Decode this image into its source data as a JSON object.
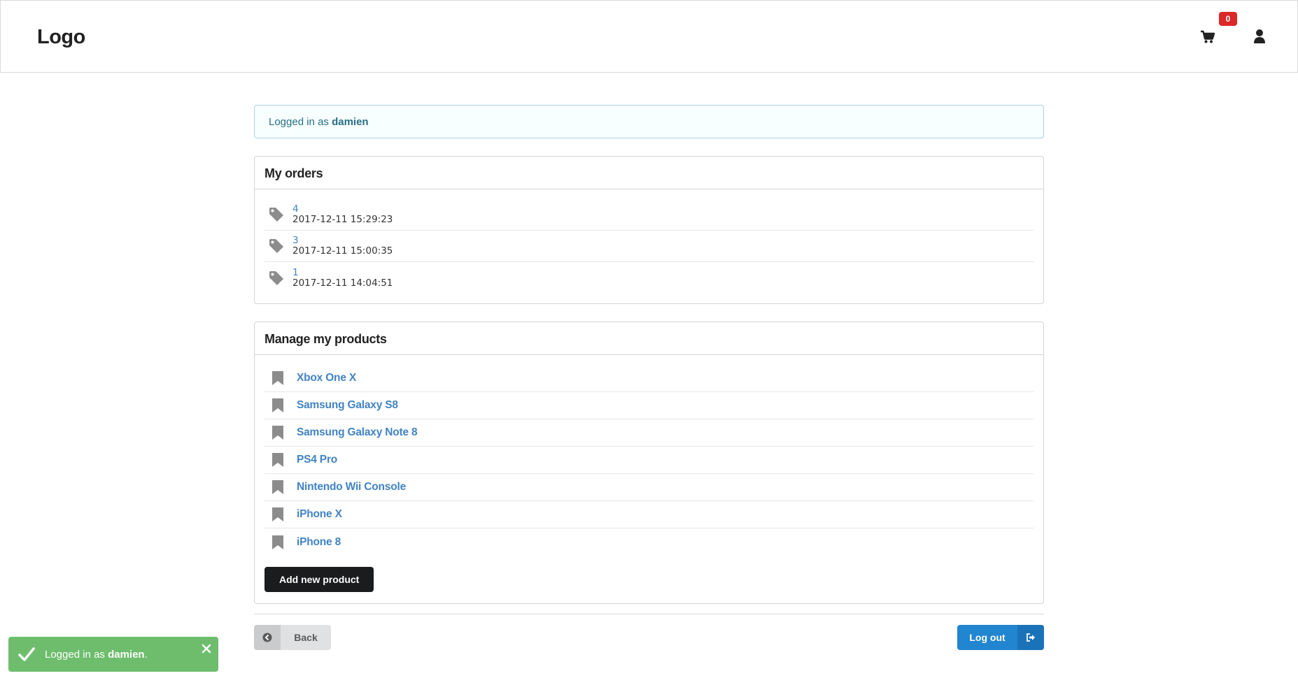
{
  "header": {
    "logo": "Logo",
    "cart_count": "0"
  },
  "info_message": {
    "prefix": "Logged in as",
    "username": "damien"
  },
  "orders": {
    "title": "My orders",
    "items": [
      {
        "id": "4",
        "date": "2017-12-11 15:29:23"
      },
      {
        "id": "3",
        "date": "2017-12-11 15:00:35"
      },
      {
        "id": "1",
        "date": "2017-12-11 14:04:51"
      }
    ]
  },
  "products": {
    "title": "Manage my products",
    "items": [
      {
        "name": "Xbox One X"
      },
      {
        "name": "Samsung Galaxy S8"
      },
      {
        "name": "Samsung Galaxy Note 8"
      },
      {
        "name": "PS4 Pro"
      },
      {
        "name": "Nintendo Wii Console"
      },
      {
        "name": "iPhone X"
      },
      {
        "name": "iPhone 8"
      }
    ],
    "add_label": "Add new product"
  },
  "footer": {
    "back_label": "Back",
    "logout_label": "Log out"
  },
  "toast": {
    "prefix": "Logged in as",
    "username": "damien",
    "suffix": "."
  },
  "colors": {
    "link": "#4183c4",
    "primary": "#2185d0",
    "success": "#6dbd6d",
    "badge": "#db2828"
  }
}
